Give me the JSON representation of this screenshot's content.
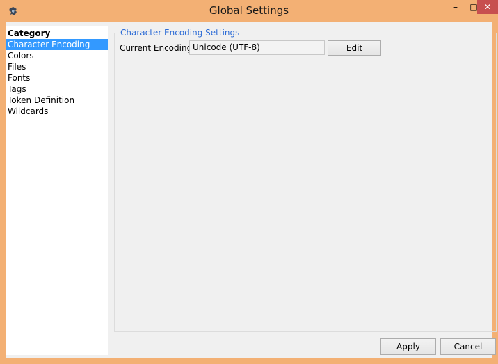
{
  "window": {
    "title": "Global Settings",
    "minimize_glyph": "–",
    "maximize_glyph": "□",
    "close_glyph": "✕",
    "app_icon": "app-icon"
  },
  "category": {
    "header": "Category",
    "items": [
      {
        "label": "Character Encoding",
        "selected": true
      },
      {
        "label": "Colors",
        "selected": false
      },
      {
        "label": "Files",
        "selected": false
      },
      {
        "label": "Fonts",
        "selected": false
      },
      {
        "label": "Tags",
        "selected": false
      },
      {
        "label": "Token Definition",
        "selected": false
      },
      {
        "label": "Wildcards",
        "selected": false
      }
    ]
  },
  "encoding_settings": {
    "group_title": "Character Encoding Settings",
    "current_label": "Current Encoding",
    "current_value": "Unicode (UTF-8)",
    "edit_label": "Edit"
  },
  "footer": {
    "apply_label": "Apply",
    "cancel_label": "Cancel"
  },
  "colors": {
    "title_bar": "#f3b074",
    "close_button": "#c74f4f",
    "selection": "#3399ff",
    "group_title": "#2b6bd6"
  }
}
